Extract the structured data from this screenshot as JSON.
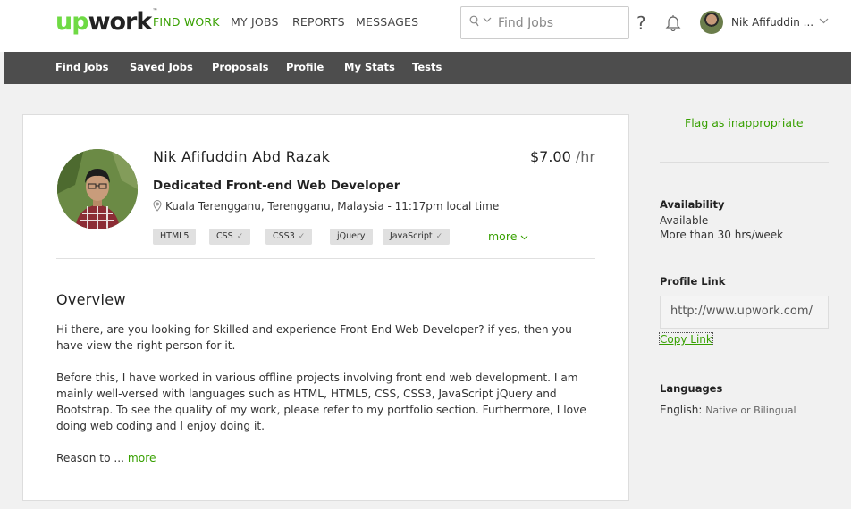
{
  "header": {
    "logo_text": "upwork",
    "logo_tm": "™",
    "nav": [
      "FIND WORK",
      "MY JOBS",
      "REPORTS",
      "MESSAGES"
    ],
    "search_placeholder": "Find Jobs",
    "help": "?",
    "user_name": "Nik Afifuddin ..."
  },
  "subnav": [
    "Find Jobs",
    "Saved Jobs",
    "Proposals",
    "Profile",
    "My Stats",
    "Tests"
  ],
  "profile": {
    "name": "Nik Afifuddin Abd Razak",
    "rate_amount": "$7.00",
    "rate_unit": "/hr",
    "title": "Dedicated Front-end Web Developer",
    "location": "Kuala Terengganu, Terengganu, Malaysia - 11:17pm local time",
    "skills": [
      {
        "label": "HTML5",
        "check": ""
      },
      {
        "label": "CSS",
        "check": "✓"
      },
      {
        "label": "CSS3",
        "check": "✓"
      },
      {
        "label": "jQuery",
        "check": ""
      },
      {
        "label": "JavaScript",
        "check": "✓"
      }
    ],
    "skills_more": "more"
  },
  "overview": {
    "heading": "Overview",
    "p1": "Hi there, are you looking for Skilled and experience Front End Web Developer? if yes, then you have view the right person for it.",
    "p2": "Before this, I have worked in various offline projects involving front end web development. I am mainly well-versed with languages such as HTML, HTML5, CSS, CSS3, JavaScript jQuery and Bootstrap. To see the quality of my work, please refer to my portfolio section. Furthermore, I love doing web coding and I enjoy doing it.",
    "p3": "Reason to ...",
    "p3_more": "more"
  },
  "sidebar": {
    "flag": "Flag as inappropriate",
    "availability_h": "Availability",
    "availability": "Available",
    "hours": "More than 30 hrs/week",
    "profile_link_h": "Profile Link",
    "profile_link_value": "http://www.upwork.com/",
    "copy_link": "Copy Link",
    "languages_h": "Languages",
    "language": "English:",
    "language_level": "Native or Bilingual"
  },
  "colors": {
    "brand_green": "#6fda44",
    "link_green": "#37a000",
    "subbar": "#4d4d4d"
  }
}
